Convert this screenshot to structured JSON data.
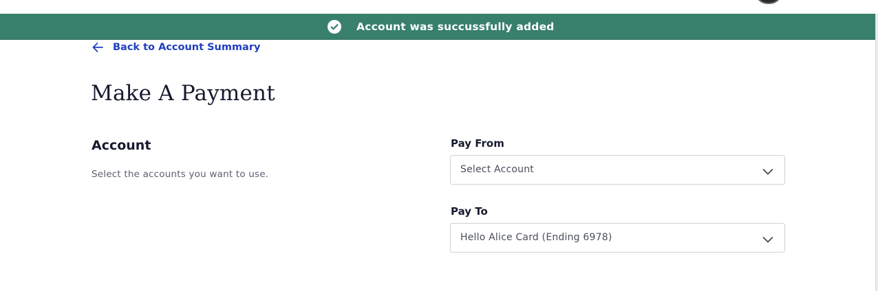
{
  "toast": {
    "message": "Account was succussfully added",
    "icon": "check-circle-icon",
    "background": "#38806b"
  },
  "back_link": {
    "label": "Back to Account Summary",
    "icon": "arrow-left-icon",
    "color": "#1f3fbf"
  },
  "page": {
    "title": "Make A Payment"
  },
  "account_section": {
    "title": "Account",
    "description": "Select the accounts you want to use."
  },
  "pay_from": {
    "label": "Pay From",
    "value": "Select Account",
    "icon": "chevron-down-icon"
  },
  "pay_to": {
    "label": "Pay To",
    "value": "Hello Alice Card (Ending 6978)",
    "icon": "chevron-down-icon"
  }
}
